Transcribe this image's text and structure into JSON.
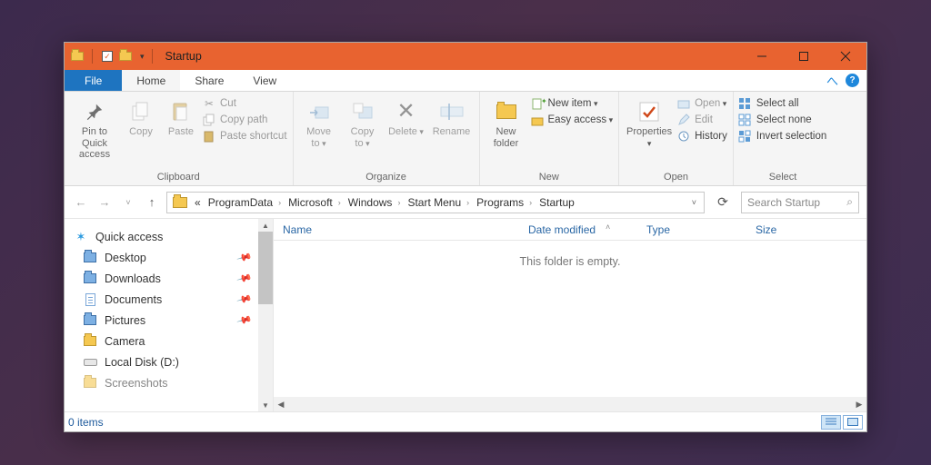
{
  "title": "Startup",
  "tabs": {
    "file": "File",
    "home": "Home",
    "share": "Share",
    "view": "View"
  },
  "ribbon": {
    "clipboard": {
      "label": "Clipboard",
      "pin": "Pin to Quick\naccess",
      "copy": "Copy",
      "paste": "Paste",
      "cut": "Cut",
      "copy_path": "Copy path",
      "paste_shortcut": "Paste shortcut"
    },
    "organize": {
      "label": "Organize",
      "move_to": "Move\nto",
      "copy_to": "Copy\nto",
      "delete": "Delete",
      "rename": "Rename"
    },
    "new": {
      "label": "New",
      "new_folder": "New\nfolder",
      "new_item": "New item",
      "easy_access": "Easy access"
    },
    "open": {
      "label": "Open",
      "properties": "Properties",
      "open": "Open",
      "edit": "Edit",
      "history": "History"
    },
    "select": {
      "label": "Select",
      "select_all": "Select all",
      "select_none": "Select none",
      "invert": "Invert selection"
    }
  },
  "breadcrumbs": [
    "ProgramData",
    "Microsoft",
    "Windows",
    "Start Menu",
    "Programs",
    "Startup"
  ],
  "search_placeholder": "Search Startup",
  "columns": {
    "name": "Name",
    "date": "Date modified",
    "type": "Type",
    "size": "Size"
  },
  "empty_message": "This folder is empty.",
  "navpane": {
    "quick_access": "Quick access",
    "items": [
      {
        "label": "Desktop",
        "icon": "desktop",
        "pinned": true
      },
      {
        "label": "Downloads",
        "icon": "downloads",
        "pinned": true
      },
      {
        "label": "Documents",
        "icon": "documents",
        "pinned": true
      },
      {
        "label": "Pictures",
        "icon": "pictures",
        "pinned": true
      },
      {
        "label": "Camera",
        "icon": "folder",
        "pinned": false
      },
      {
        "label": "Local Disk (D:)",
        "icon": "drive",
        "pinned": false
      },
      {
        "label": "Screenshots",
        "icon": "folder",
        "pinned": false
      }
    ]
  },
  "status": "0 items"
}
